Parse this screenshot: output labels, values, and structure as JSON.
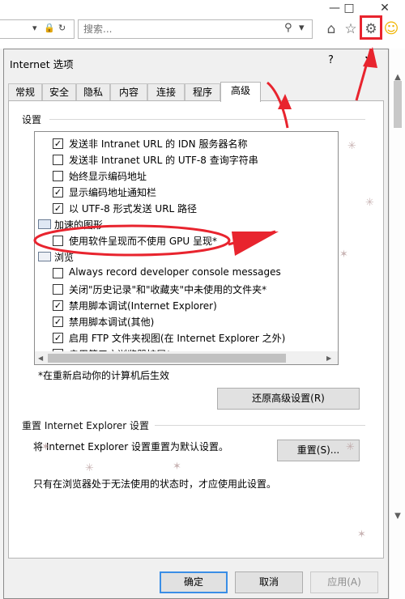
{
  "browser": {
    "minimize": "—",
    "restore": "□",
    "close": "✕",
    "search_placeholder": "搜索...",
    "icons": [
      "lock-icon",
      "refresh-icon",
      "search-icon",
      "home-icon",
      "star-icon",
      "gear-icon",
      "smiley-icon"
    ]
  },
  "dialog": {
    "title": "Internet 选项",
    "help": "?",
    "close": "✕",
    "tabs": [
      "常规",
      "安全",
      "隐私",
      "内容",
      "连接",
      "程序",
      "高级"
    ],
    "active_tab": "高级",
    "settings_label": "设置",
    "settings": [
      {
        "type": "check",
        "checked": true,
        "label": "发送非 Intranet URL 的 IDN 服务器名称"
      },
      {
        "type": "check",
        "checked": false,
        "label": "发送非 Intranet URL 的 UTF-8 查询字符串"
      },
      {
        "type": "check",
        "checked": false,
        "label": "始终显示编码地址"
      },
      {
        "type": "check",
        "checked": true,
        "label": "显示编码地址通知栏"
      },
      {
        "type": "check",
        "checked": true,
        "label": "以 UTF-8 形式发送 URL 路径"
      },
      {
        "type": "category",
        "label": "加速的图形"
      },
      {
        "type": "check",
        "checked": false,
        "label": "使用软件呈现而不使用 GPU 呈现*"
      },
      {
        "type": "category",
        "label": "浏览"
      },
      {
        "type": "check",
        "checked": false,
        "label": "Always record developer console messages"
      },
      {
        "type": "check",
        "checked": false,
        "label": "关闭\"历史记录\"和\"收藏夹\"中未使用的文件夹*"
      },
      {
        "type": "check",
        "checked": true,
        "label": "禁用脚本调试(Internet Explorer)"
      },
      {
        "type": "check",
        "checked": true,
        "label": "禁用脚本调试(其他)"
      },
      {
        "type": "check",
        "checked": true,
        "label": "启用 FTP 文件夹视图(在 Internet Explorer 之外)"
      },
      {
        "type": "check",
        "checked": false,
        "label": "启用第三方浏览器扩展*"
      }
    ],
    "restart_note": "*在重新启动你的计算机后生效",
    "restore_button": "还原高级设置(R)",
    "reset_group_label": "重置 Internet Explorer 设置",
    "reset_desc": "将 Internet Explorer 设置重置为默认设置。",
    "reset_button": "重置(S)...",
    "reset_note": "只有在浏览器处于无法使用的状态时，才应使用此设置。",
    "ok_button": "确定",
    "cancel_button": "取消",
    "apply_button": "应用(A)"
  },
  "colors": {
    "annotation": "#e8242e",
    "accent": "#3a8ee6"
  }
}
